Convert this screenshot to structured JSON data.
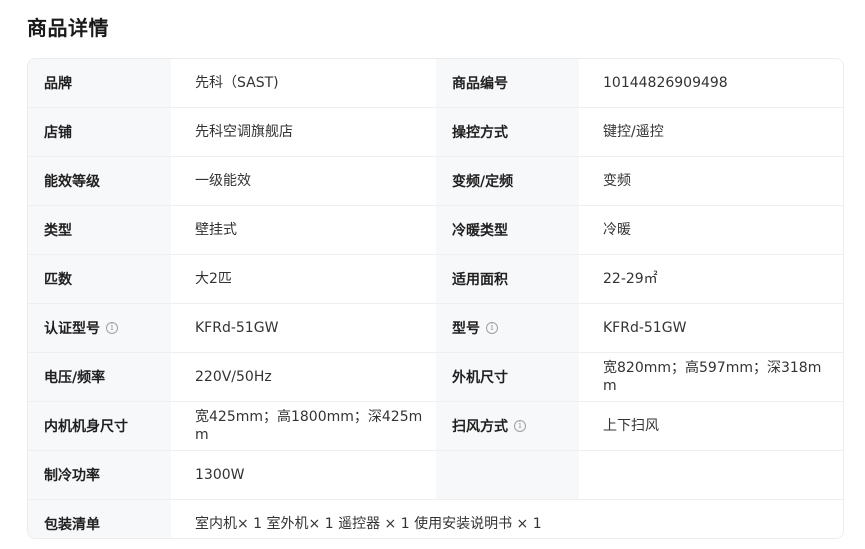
{
  "page": {
    "title": "商品详情"
  },
  "specs": {
    "brand_label": "品牌",
    "brand_value": "先科（SAST)",
    "sku_label": "商品编号",
    "sku_value": "10144826909498",
    "store_label": "店铺",
    "store_value": "先科空调旗舰店",
    "control_label": "操控方式",
    "control_value": "键控/遥控",
    "energy_label": "能效等级",
    "energy_value": "一级能效",
    "freq_label": "变频/定频",
    "freq_value": "变频",
    "type_label": "类型",
    "type_value": "壁挂式",
    "cooling_type_label": "冷暖类型",
    "cooling_type_value": "冷暖",
    "hp_label": "匹数",
    "hp_value": "大2匹",
    "area_label": "适用面积",
    "area_value": "22-29㎡",
    "cert_model_label": "认证型号",
    "cert_model_value": "KFRd-51GW",
    "model_label": "型号",
    "model_value": "KFRd-51GW",
    "voltage_label": "电压/频率",
    "voltage_value": "220V/50Hz",
    "outdoor_size_label": "外机尺寸",
    "outdoor_size_value": "宽820mm；高597mm；深318mm",
    "indoor_size_label": "内机机身尺寸",
    "indoor_size_value": "宽425mm；高1800mm；深425mm",
    "swing_label": "扫风方式",
    "swing_value": "上下扫风",
    "cooling_power_label": "制冷功率",
    "cooling_power_value": "1300W",
    "package_label": "包装清单",
    "package_value": "室内机× 1 室外机× 1 遥控器 × 1 使用安装说明书 × 1"
  },
  "icons": {
    "info": "info-icon"
  }
}
